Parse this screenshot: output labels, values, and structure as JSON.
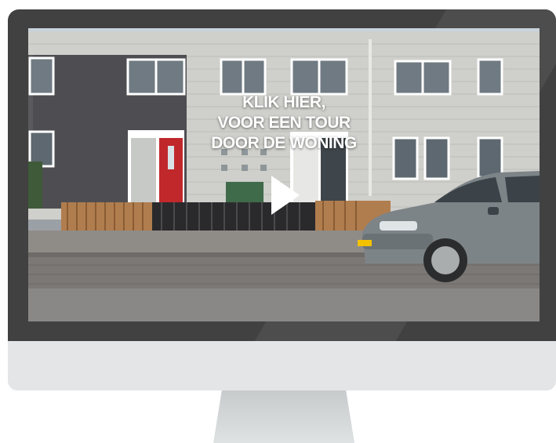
{
  "video": {
    "cta_line1": "KLIK HIER,",
    "cta_line2": "VOOR EEN TOUR",
    "cta_line3": "DOOR DE WONING"
  },
  "icons": {
    "play": "play-icon"
  },
  "colors": {
    "bezel": "#414141",
    "chin": "#e3e5e6",
    "stand": "#d0d3d4",
    "cta_text": "#ffffff",
    "front_door": "#c0282c"
  }
}
